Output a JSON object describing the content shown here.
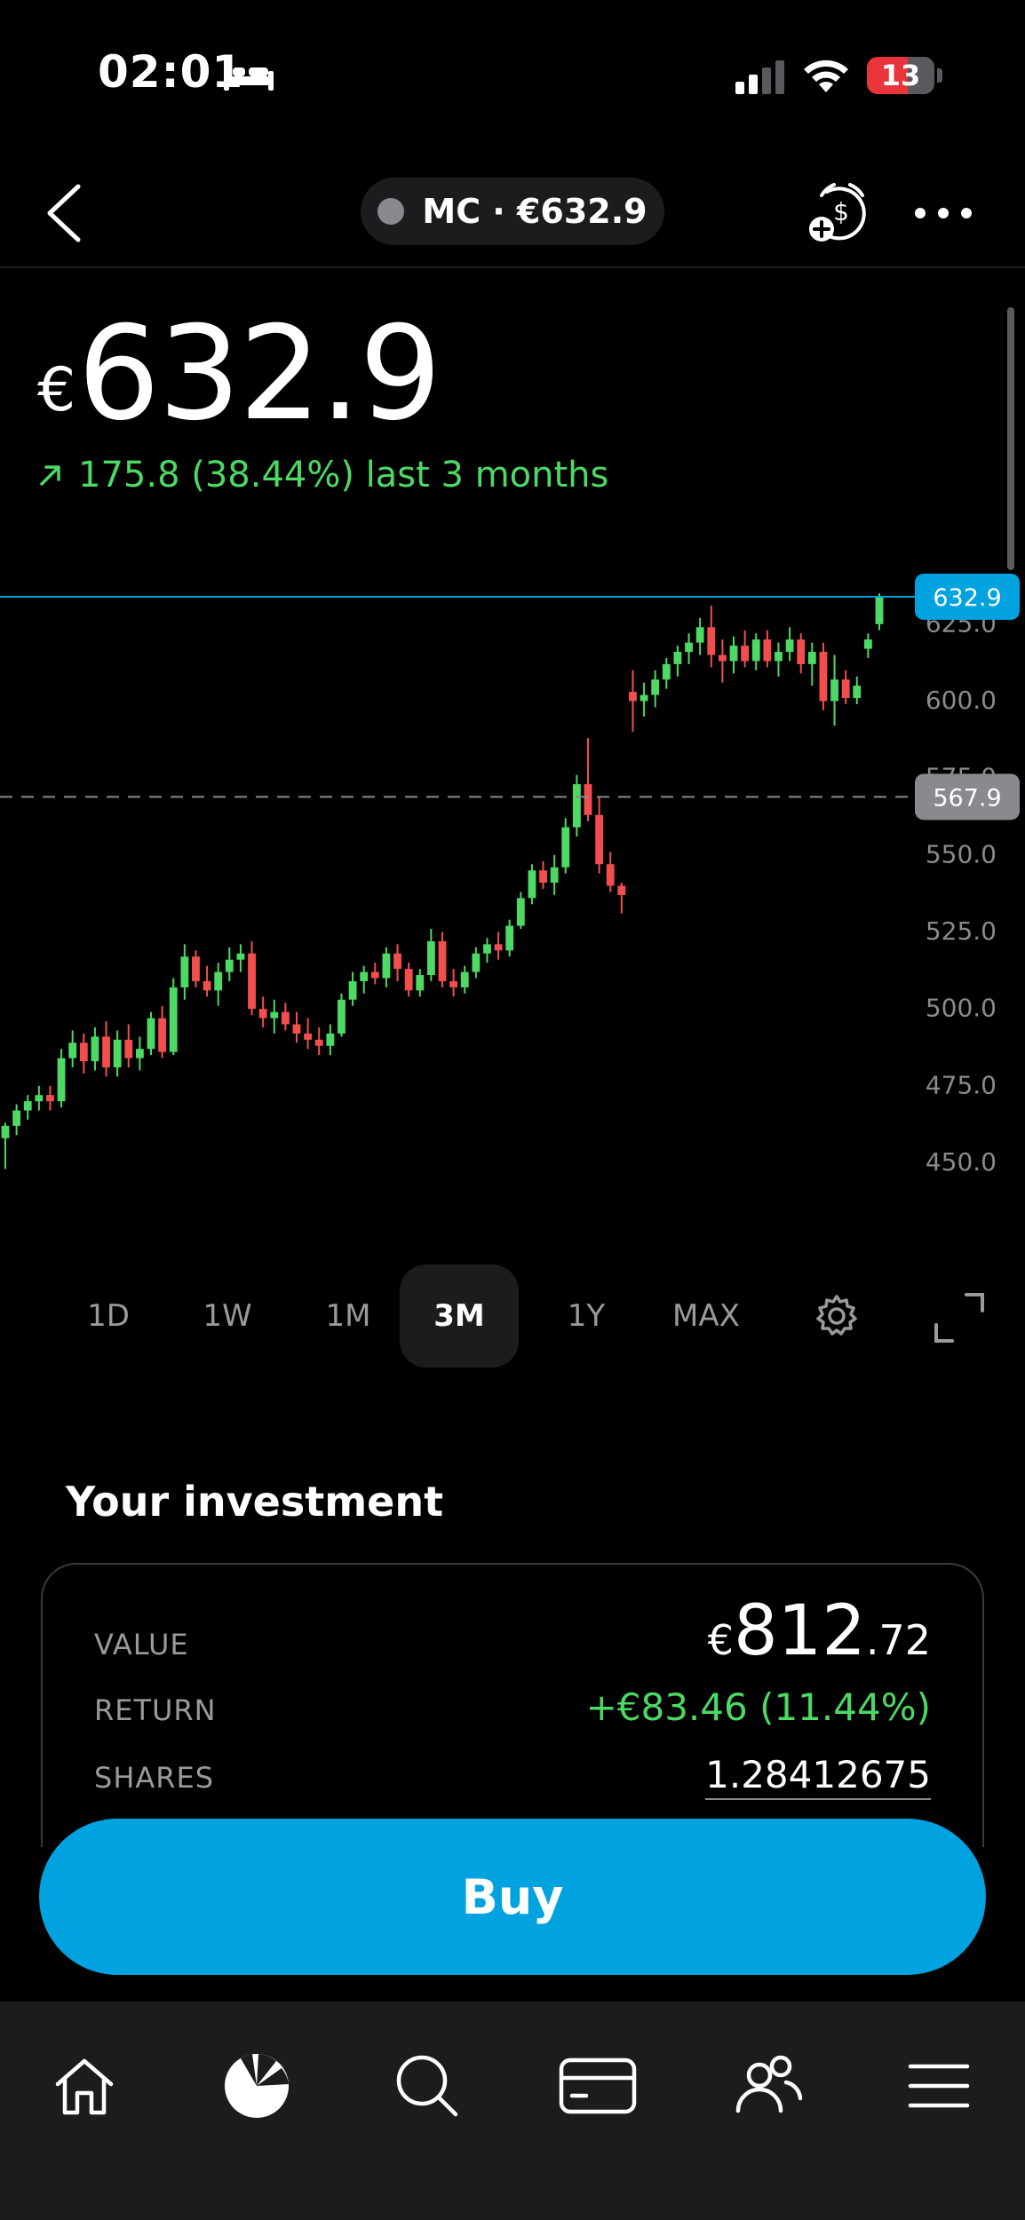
{
  "status_bar": {
    "time": "02:01",
    "battery": "13"
  },
  "header": {
    "ticker_label": "MC · €632.9"
  },
  "price": {
    "currency": "€",
    "value": "632.9",
    "change": "175.8 (38.44%) last 3 months"
  },
  "chart_data": {
    "type": "candlestick",
    "y_ticks": [
      "625.0",
      "600.0",
      "575.0",
      "550.0",
      "525.0",
      "500.0",
      "475.0",
      "450.0"
    ],
    "current_price_label": "632.9",
    "reference_price_label": "567.9",
    "ylim": [
      435,
      660
    ],
    "candles": [
      {
        "o": 457,
        "h": 462,
        "l": 447,
        "c": 461
      },
      {
        "o": 461,
        "h": 468,
        "l": 458,
        "c": 466
      },
      {
        "o": 466,
        "h": 471,
        "l": 463,
        "c": 469
      },
      {
        "o": 469,
        "h": 474,
        "l": 466,
        "c": 471
      },
      {
        "o": 471,
        "h": 474,
        "l": 466,
        "c": 469
      },
      {
        "o": 469,
        "h": 486,
        "l": 467,
        "c": 483
      },
      {
        "o": 483,
        "h": 492,
        "l": 480,
        "c": 488
      },
      {
        "o": 488,
        "h": 491,
        "l": 478,
        "c": 482
      },
      {
        "o": 482,
        "h": 493,
        "l": 479,
        "c": 490
      },
      {
        "o": 490,
        "h": 495,
        "l": 477,
        "c": 480
      },
      {
        "o": 480,
        "h": 492,
        "l": 477,
        "c": 489
      },
      {
        "o": 489,
        "h": 494,
        "l": 480,
        "c": 483
      },
      {
        "o": 483,
        "h": 490,
        "l": 479,
        "c": 486
      },
      {
        "o": 486,
        "h": 498,
        "l": 484,
        "c": 496
      },
      {
        "o": 496,
        "h": 500,
        "l": 483,
        "c": 485
      },
      {
        "o": 485,
        "h": 509,
        "l": 484,
        "c": 506
      },
      {
        "o": 506,
        "h": 520,
        "l": 502,
        "c": 516
      },
      {
        "o": 516,
        "h": 518,
        "l": 506,
        "c": 508
      },
      {
        "o": 508,
        "h": 513,
        "l": 503,
        "c": 505
      },
      {
        "o": 505,
        "h": 514,
        "l": 500,
        "c": 511
      },
      {
        "o": 511,
        "h": 519,
        "l": 508,
        "c": 515
      },
      {
        "o": 515,
        "h": 520,
        "l": 511,
        "c": 517
      },
      {
        "o": 517,
        "h": 521,
        "l": 497,
        "c": 499
      },
      {
        "o": 499,
        "h": 503,
        "l": 493,
        "c": 496
      },
      {
        "o": 496,
        "h": 502,
        "l": 491,
        "c": 498
      },
      {
        "o": 498,
        "h": 501,
        "l": 492,
        "c": 494
      },
      {
        "o": 494,
        "h": 498,
        "l": 488,
        "c": 491
      },
      {
        "o": 491,
        "h": 496,
        "l": 486,
        "c": 489
      },
      {
        "o": 489,
        "h": 493,
        "l": 484,
        "c": 487
      },
      {
        "o": 487,
        "h": 494,
        "l": 484,
        "c": 491
      },
      {
        "o": 491,
        "h": 504,
        "l": 490,
        "c": 502
      },
      {
        "o": 502,
        "h": 511,
        "l": 500,
        "c": 508
      },
      {
        "o": 508,
        "h": 513,
        "l": 504,
        "c": 511
      },
      {
        "o": 511,
        "h": 514,
        "l": 507,
        "c": 509
      },
      {
        "o": 509,
        "h": 519,
        "l": 506,
        "c": 517
      },
      {
        "o": 517,
        "h": 520,
        "l": 508,
        "c": 512
      },
      {
        "o": 512,
        "h": 514,
        "l": 503,
        "c": 505
      },
      {
        "o": 505,
        "h": 512,
        "l": 503,
        "c": 510
      },
      {
        "o": 510,
        "h": 525,
        "l": 508,
        "c": 521
      },
      {
        "o": 521,
        "h": 524,
        "l": 506,
        "c": 508
      },
      {
        "o": 508,
        "h": 512,
        "l": 503,
        "c": 506
      },
      {
        "o": 506,
        "h": 513,
        "l": 504,
        "c": 511
      },
      {
        "o": 511,
        "h": 519,
        "l": 509,
        "c": 517
      },
      {
        "o": 517,
        "h": 522,
        "l": 514,
        "c": 520
      },
      {
        "o": 520,
        "h": 524,
        "l": 515,
        "c": 518
      },
      {
        "o": 518,
        "h": 528,
        "l": 516,
        "c": 526
      },
      {
        "o": 526,
        "h": 537,
        "l": 525,
        "c": 535
      },
      {
        "o": 535,
        "h": 546,
        "l": 533,
        "c": 544
      },
      {
        "o": 544,
        "h": 547,
        "l": 538,
        "c": 540
      },
      {
        "o": 540,
        "h": 549,
        "l": 536,
        "c": 545
      },
      {
        "o": 545,
        "h": 561,
        "l": 543,
        "c": 558
      },
      {
        "o": 558,
        "h": 575,
        "l": 555,
        "c": 572
      },
      {
        "o": 572,
        "h": 587,
        "l": 560,
        "c": 562
      },
      {
        "o": 562,
        "h": 568,
        "l": 543,
        "c": 546
      },
      {
        "o": 546,
        "h": 550,
        "l": 537,
        "c": 539
      },
      {
        "o": 539,
        "h": 540,
        "l": 530,
        "c": 536
      },
      {
        "o": 602,
        "h": 609,
        "l": 589,
        "c": 599
      },
      {
        "o": 599,
        "h": 605,
        "l": 594,
        "c": 601
      },
      {
        "o": 601,
        "h": 609,
        "l": 597,
        "c": 606
      },
      {
        "o": 606,
        "h": 613,
        "l": 603,
        "c": 611
      },
      {
        "o": 611,
        "h": 617,
        "l": 607,
        "c": 615
      },
      {
        "o": 615,
        "h": 621,
        "l": 611,
        "c": 618
      },
      {
        "o": 618,
        "h": 626,
        "l": 614,
        "c": 623
      },
      {
        "o": 623,
        "h": 630,
        "l": 610,
        "c": 614
      },
      {
        "o": 614,
        "h": 619,
        "l": 605,
        "c": 612
      },
      {
        "o": 612,
        "h": 620,
        "l": 608,
        "c": 617
      },
      {
        "o": 617,
        "h": 622,
        "l": 610,
        "c": 612
      },
      {
        "o": 612,
        "h": 621,
        "l": 609,
        "c": 619
      },
      {
        "o": 619,
        "h": 622,
        "l": 610,
        "c": 612
      },
      {
        "o": 612,
        "h": 618,
        "l": 607,
        "c": 615
      },
      {
        "o": 615,
        "h": 623,
        "l": 612,
        "c": 619
      },
      {
        "o": 619,
        "h": 621,
        "l": 608,
        "c": 611
      },
      {
        "o": 611,
        "h": 618,
        "l": 604,
        "c": 615
      },
      {
        "o": 615,
        "h": 618,
        "l": 596,
        "c": 599
      },
      {
        "o": 599,
        "h": 614,
        "l": 591,
        "c": 606
      },
      {
        "o": 606,
        "h": 609,
        "l": 598,
        "c": 600
      },
      {
        "o": 600,
        "h": 607,
        "l": 598,
        "c": 604
      },
      {
        "o": 616,
        "h": 621,
        "l": 613,
        "c": 619
      },
      {
        "o": 624,
        "h": 634,
        "l": 622,
        "c": 632.9
      }
    ]
  },
  "range_tabs": [
    {
      "label": "1D",
      "active": false
    },
    {
      "label": "1W",
      "active": false
    },
    {
      "label": "1M",
      "active": false
    },
    {
      "label": "3M",
      "active": true
    },
    {
      "label": "1Y",
      "active": false
    },
    {
      "label": "MAX",
      "active": false
    }
  ],
  "investment": {
    "title": "Your investment",
    "value_label": "VALUE",
    "value_currency": "€",
    "value_int": "812",
    "value_dec": ".72",
    "return_label": "RETURN",
    "return_value": "+€83.46 (11.44%)",
    "shares_label": "SHARES",
    "shares_value": "1.28412675"
  },
  "buy_label": "Buy",
  "colors": {
    "up": "#4cd964",
    "down": "#f24e4e",
    "accent": "#00a2e0",
    "reference": "#8a8a8e"
  }
}
